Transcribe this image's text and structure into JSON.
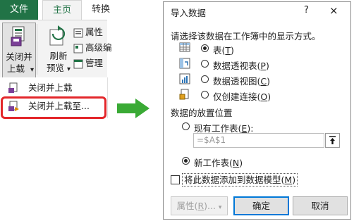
{
  "ribbon": {
    "tabs": {
      "file": "文件",
      "home": "主页",
      "convert": "转换"
    },
    "close_load": {
      "line1": "关闭并",
      "line2": "上载",
      "caret": "▾"
    },
    "refresh": {
      "line1": "刷新",
      "line2": "预览",
      "caret": "▾"
    },
    "small_buttons": {
      "properties": "属性",
      "advanced": "高级编",
      "manage": "管理"
    },
    "menu": {
      "item1": "关闭并上载",
      "item2": "关闭并上载至..."
    }
  },
  "dialog": {
    "title": "导入数据",
    "help": "?",
    "close": "×",
    "prompt": "请选择该数据在工作簿中的显示方式。",
    "view_options": [
      {
        "label": "表",
        "hotkey": "T",
        "selected": true
      },
      {
        "label": "数据透视表",
        "hotkey": "P",
        "selected": false
      },
      {
        "label": "数据透视图",
        "hotkey": "C",
        "selected": false
      },
      {
        "label": "仅创建连接",
        "hotkey": "O",
        "selected": false
      }
    ],
    "placement_heading": "数据的放置位置",
    "existing_sheet": {
      "label": "现有工作表",
      "hotkey": "E",
      "suffix": ":",
      "selected": false
    },
    "reference_value": "=$A$1",
    "new_sheet": {
      "label": "新工作表",
      "hotkey": "N",
      "selected": true
    },
    "add_to_model": {
      "label": "将此数据添加到数据模型",
      "hotkey": "M",
      "checked": false
    },
    "buttons": {
      "properties": "属性",
      "properties_hotkey": "R",
      "properties_suffix": "...",
      "ok": "确定",
      "cancel": "取消"
    }
  },
  "colors": {
    "excel_green": "#217346",
    "highlight_red": "#e3262a",
    "arrow_green": "#3aaa35",
    "focus_blue": "#0078d7"
  }
}
